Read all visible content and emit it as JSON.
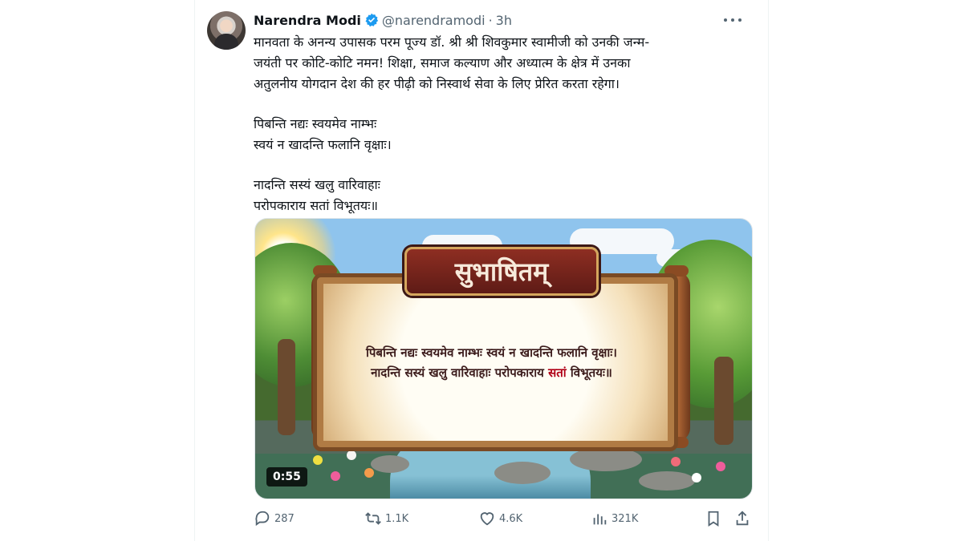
{
  "author": {
    "name": "Narendra Modi",
    "handle": "@narendramodi",
    "separator": "·",
    "time": "3h"
  },
  "tweet": {
    "lines": [
      "मानवता के अनन्य उपासक परम पूज्य डॉ. श्री श्री शिवकुमार स्वामीजी को उनकी जन्म-",
      "जयंती पर कोटि-कोटि नमन! शिक्षा, समाज कल्याण और अध्यात्म के क्षेत्र में उनका",
      "अतुलनीय योगदान देश की हर पीढ़ी को निस्वार्थ सेवा के लिए प्रेरित करता रहेगा।",
      "",
      "पिबन्ति नद्यः स्वयमेव नाम्भः",
      "स्वयं न खादन्ति फलानि वृक्षाः।",
      "",
      "नादन्ति सस्यं खलु वारिवाहाः",
      "परोपकाराय सतां विभूतयः॥"
    ]
  },
  "media": {
    "title": "सुभाषितम्",
    "verse_line1": "पिबन्ति नद्यः स्वयमेव नाम्भः स्वयं न खादन्ति फलानि वृक्षाः।",
    "verse_line2_before": "नादन्ति सस्यं खलु वारिवाहाः परोपकाराय ",
    "verse_line2_highlight": "सतां",
    "verse_line2_after": " विभूतयः॥",
    "duration": "0:55"
  },
  "actions": {
    "replies": "287",
    "reposts": "1.1K",
    "likes": "4.6K",
    "views": "321K"
  },
  "colors": {
    "primary_text": "#0f1419",
    "secondary_text": "#536471",
    "verified_blue": "#1d9bf0",
    "highlight_red": "#b00016"
  },
  "icons": [
    "verified-icon",
    "more-icon",
    "reply-icon",
    "repost-icon",
    "like-icon",
    "views-icon",
    "bookmark-icon",
    "share-icon"
  ]
}
